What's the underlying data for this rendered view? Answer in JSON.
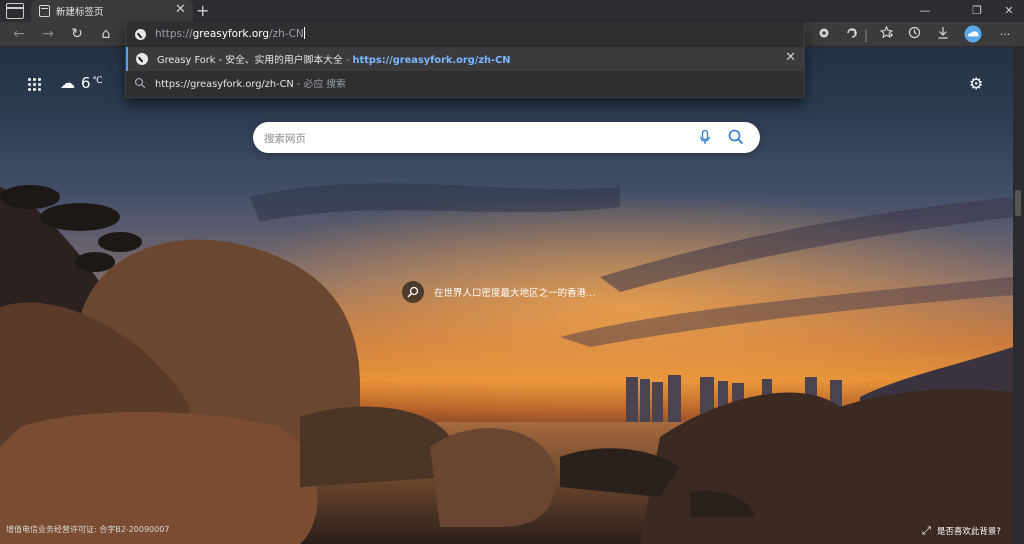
{
  "tabs": [
    {
      "title": "新建标签页",
      "close": "✕"
    }
  ],
  "new_tab_symbol": "+",
  "window_controls": {
    "minimize": "—",
    "maximize": "❐",
    "close": "✕"
  },
  "toolbar": {
    "back": "←",
    "forward": "→",
    "refresh": "↻",
    "home": "⌂",
    "icons": [
      "extension-icon",
      "extension-icon",
      "favorites-icon",
      "collections-icon",
      "history-icon",
      "downloads-icon",
      "profile-icon",
      "more-icon"
    ],
    "more_symbol": "···"
  },
  "omnibox": {
    "url_scheme": "https://",
    "url_host": "greasyfork.org",
    "url_path": "/zh-CN",
    "suggestions": [
      {
        "title": "Greasy Fork - 安全、实用的用户脚本大全",
        "separator": " - ",
        "url": "https://greasyfork.org/zh-CN",
        "remove": "✕"
      },
      {
        "text": "https://greasyfork.org/zh-CN",
        "suffix": " - 必应 搜索"
      }
    ]
  },
  "newtab": {
    "weather_temp": "6",
    "weather_unit": "℃",
    "search_placeholder": "搜索网页",
    "image_caption": "在世界人口密度最大地区之一的香港…",
    "license_text": "增值电信业务经营许可证: 合字B2-20090007",
    "like_background": "是否喜欢此背景?"
  },
  "colors": {
    "accent": "#4fa3f7",
    "link": "#7cb8ff",
    "toolbar_bg": "#3b3b3b",
    "omnibox_bg": "#2f2f31"
  }
}
